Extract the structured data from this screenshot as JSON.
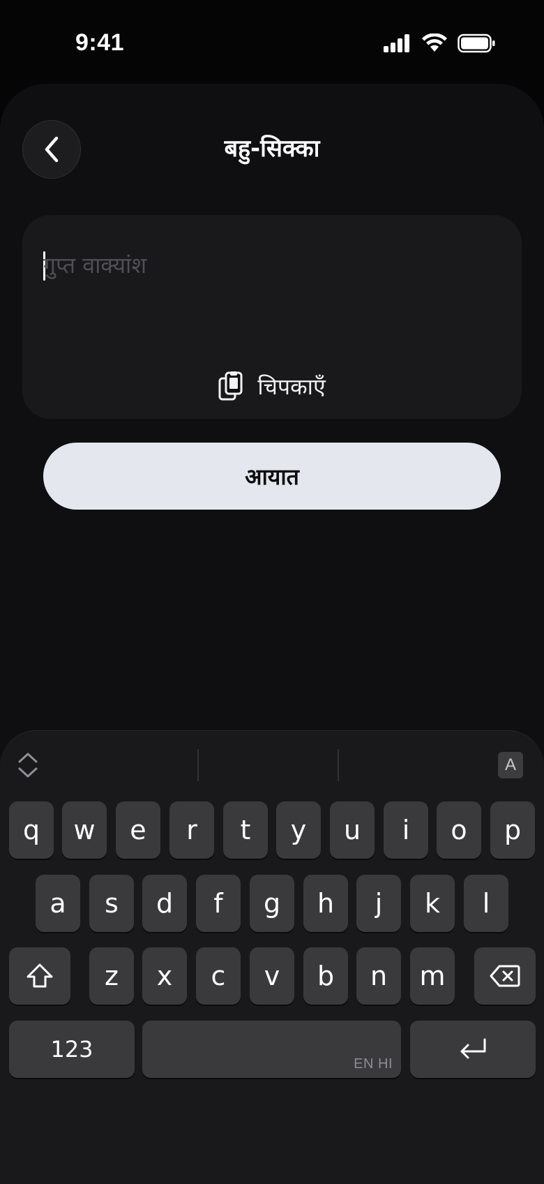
{
  "status_bar": {
    "time": "9:41"
  },
  "header": {
    "title": "बहु-सिक्का",
    "back_icon": "chevron-left-icon"
  },
  "phrase_input": {
    "placeholder": "गुप्त वाक्यांश",
    "value": ""
  },
  "paste": {
    "label": "चिपकाएँ",
    "icon": "clipboard-icon"
  },
  "import_button": {
    "label": "आयात"
  },
  "keyboard": {
    "format_key": "A",
    "row1": [
      "q",
      "w",
      "e",
      "r",
      "t",
      "y",
      "u",
      "i",
      "o",
      "p"
    ],
    "row2": [
      "a",
      "s",
      "d",
      "f",
      "g",
      "h",
      "j",
      "k",
      "l"
    ],
    "row3": [
      "z",
      "x",
      "c",
      "v",
      "b",
      "n",
      "m"
    ],
    "numbers_key": "123",
    "space_hint": "EN HI"
  }
}
